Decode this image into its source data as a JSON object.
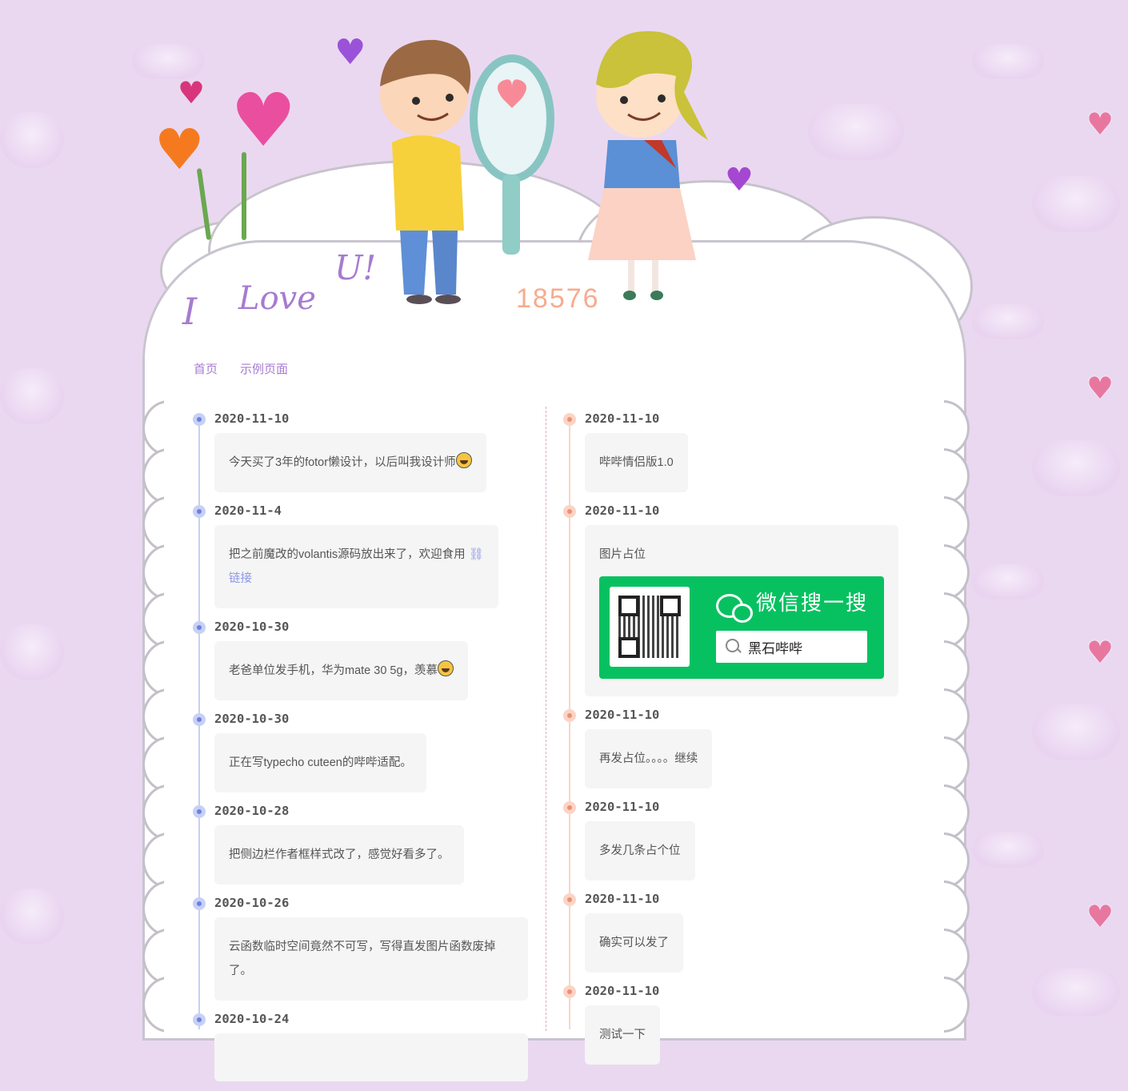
{
  "site": {
    "title_number": "18576",
    "logo_text": [
      "I",
      "Love",
      "U!"
    ]
  },
  "nav": {
    "items": [
      "首页",
      "示例页面"
    ]
  },
  "left_timeline": [
    {
      "date": "2020-11-10",
      "text": "今天买了3年的fotor懒设计，以后叫我设计师",
      "emoji": "grin-sweat-emoji"
    },
    {
      "date": "2020-11-4",
      "text": "把之前魔改的volantis源码放出来了，欢迎食用",
      "link_text": "链接",
      "link_icon": "link-icon"
    },
    {
      "date": "2020-10-30",
      "text": "老爸单位发手机，华为mate 30 5g，羡慕",
      "emoji": "grin-sweat-emoji"
    },
    {
      "date": "2020-10-30",
      "text": "正在写typecho cuteen的哔哔适配。"
    },
    {
      "date": "2020-10-28",
      "text": "把侧边栏作者框样式改了，感觉好看多了。"
    },
    {
      "date": "2020-10-26",
      "text": "云函数临时空间竟然不可写，写得直发图片函数废掉了。"
    },
    {
      "date": "2020-10-24",
      "text": ""
    }
  ],
  "right_timeline": [
    {
      "date": "2020-11-10",
      "text": "哔哔情侣版1.0"
    },
    {
      "date": "2020-11-10",
      "text": "图片占位",
      "wechat_card": {
        "title": "微信搜一搜",
        "search_text": "黑石哔哔"
      }
    },
    {
      "date": "2020-11-10",
      "text": "再发占位。。。。继续"
    },
    {
      "date": "2020-11-10",
      "text": "多发几条占个位"
    },
    {
      "date": "2020-11-10",
      "text": "确实可以发了"
    },
    {
      "date": "2020-11-10",
      "text": "测试一下"
    }
  ],
  "colors": {
    "background": "#ead8f1",
    "accent": "#a77bd0",
    "left_dot": "#6d7fe0",
    "right_dot": "#ef8f73",
    "wechat_green": "#07c160"
  }
}
